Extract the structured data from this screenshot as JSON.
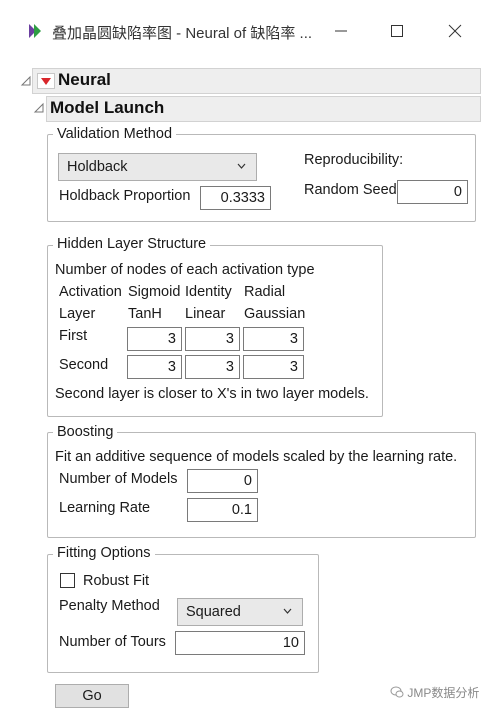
{
  "window": {
    "title": "叠加晶圆缺陷率图 - Neural of 缺陷率 ...",
    "icons": [
      "app-icon",
      "minimize-icon",
      "maximize-icon",
      "close-icon"
    ]
  },
  "outline": {
    "neural_title": "Neural",
    "model_launch_title": "Model Launch"
  },
  "validation": {
    "legend": "Validation Method",
    "method_value": "Holdback",
    "holdback_label": "Holdback Proportion",
    "holdback_value": "0.3333",
    "reproducibility_label": "Reproducibility:",
    "random_seed_label": "Random Seed",
    "random_seed_value": "0"
  },
  "hidden": {
    "legend": "Hidden Layer Structure",
    "description": "Number of nodes of each activation type",
    "header1": {
      "activation": "Activation",
      "sigmoid": "Sigmoid",
      "identity": "Identity",
      "radial": "Radial"
    },
    "header2": {
      "layer": "Layer",
      "tanh": "TanH",
      "linear": "Linear",
      "gaussian": "Gaussian"
    },
    "rows": [
      {
        "label": "First",
        "tanh": "3",
        "linear": "3",
        "gaussian": "3"
      },
      {
        "label": "Second",
        "tanh": "3",
        "linear": "3",
        "gaussian": "3"
      }
    ],
    "note": "Second layer is closer to X's in two layer models."
  },
  "boosting": {
    "legend": "Boosting",
    "description": "Fit an additive sequence of models scaled by the learning rate.",
    "num_models_label": "Number of Models",
    "num_models_value": "0",
    "learning_rate_label": "Learning Rate",
    "learning_rate_value": "0.1"
  },
  "fitting": {
    "legend": "Fitting Options",
    "robust_fit_label": "Robust Fit",
    "robust_fit_checked": false,
    "penalty_label": "Penalty Method",
    "penalty_value": "Squared",
    "tours_label": "Number of Tours",
    "tours_value": "10"
  },
  "actions": {
    "go_label": "Go"
  },
  "watermark": "JMP数据分析",
  "colors": {
    "disclosure_red": "#d9262b",
    "app_icon_purple": "#6b3fa0",
    "app_icon_green": "#2f9e44"
  }
}
